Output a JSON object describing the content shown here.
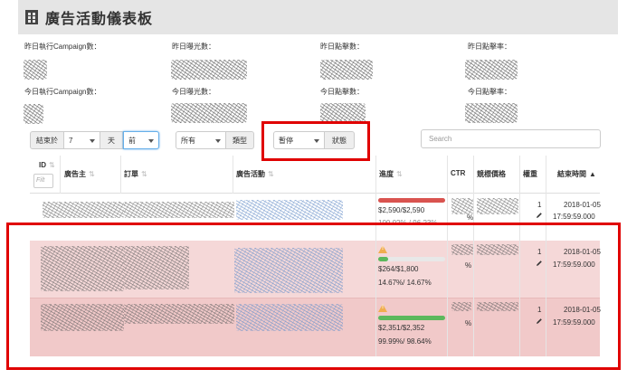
{
  "header": {
    "title": "廣告活動儀表板"
  },
  "stats": {
    "yesterday_campaigns": "昨日執行Campaign數：",
    "yesterday_impressions": "昨日曝光數：",
    "yesterday_clicks": "昨日點擊數：",
    "yesterday_ctr": "昨日點擊率：",
    "today_campaigns": "今日執行Campaign數：",
    "today_impressions": "今日曝光數：",
    "today_clicks": "今日點擊數：",
    "today_ctr": "今日點擊率："
  },
  "filters": {
    "end_label": "結束於",
    "days_value": "7",
    "days_unit": "天",
    "direction_value": "前",
    "type_value": "所有",
    "type_label": "類型",
    "status_value": "暫停",
    "status_label": "狀態",
    "search_placeholder": "Search"
  },
  "table": {
    "columns": {
      "id": "ID",
      "advertiser": "廣告主",
      "order": "訂單",
      "campaign": "廣告活動",
      "progress": "進度",
      "ctr": "CTR",
      "bid": "競標價格",
      "weight": "權重",
      "end_time": "結束時間"
    },
    "id_filter_placeholder": "Filt",
    "rows": [
      {
        "progress_amount": "$2,590/$2,590",
        "progress_pct": "100.0?% / 96.?3%",
        "ctr": "%",
        "weight": "1",
        "end_date": "2018-01-05",
        "end_time": "17:59:59.000",
        "progress_fraction": 1.0,
        "bar_color": "#d9534f",
        "warning": false
      },
      {
        "progress_amount": "$264/$1,800",
        "progress_pct": "14.67%/ 14.67%",
        "ctr": "%",
        "weight": "1",
        "end_date": "2018-01-05",
        "end_time": "17:59:59.000",
        "progress_fraction": 0.1467,
        "bar_color": "#5cb85c",
        "warning": true
      },
      {
        "progress_amount": "$2,351/$2,352",
        "progress_pct": "99.99%/ 98.64%",
        "ctr": "%",
        "weight": "1",
        "end_date": "2018-01-05",
        "end_time": "17:59:59.000",
        "progress_fraction": 0.9999,
        "bar_color": "#5cb85c",
        "warning": true
      }
    ]
  }
}
